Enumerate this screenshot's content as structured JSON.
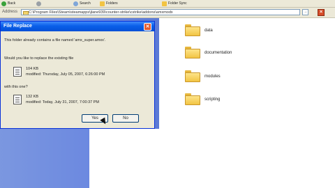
{
  "toolbar": {
    "back": "Back",
    "search": "Search",
    "folders": "Folders",
    "folder_sync": "Folder Sync"
  },
  "address": {
    "label": "Address",
    "path": "C:\\Program Files\\Steam\\steamapps\\jlane939\\counter-strike\\cstrike\\addons\\amxmodx",
    "go": "→"
  },
  "folders": [
    {
      "label": "data"
    },
    {
      "label": "documentation"
    },
    {
      "label": "modules"
    },
    {
      "label": "scripting"
    }
  ],
  "dialog": {
    "title": "File Replace",
    "message": "This folder already contains a file named 'amx_super.amxx'.",
    "question": "Would you like to replace the existing file",
    "existing": {
      "size": "104 KB",
      "modified": "modified: Thursday, July 05, 2007, 6:26:00 PM"
    },
    "with_label": "with this one?",
    "new": {
      "size": "132 KB",
      "modified": "modified: Today, July 31, 2007, 7:00:37 PM"
    },
    "yes": "Yes",
    "no": "No",
    "close": "✕"
  }
}
